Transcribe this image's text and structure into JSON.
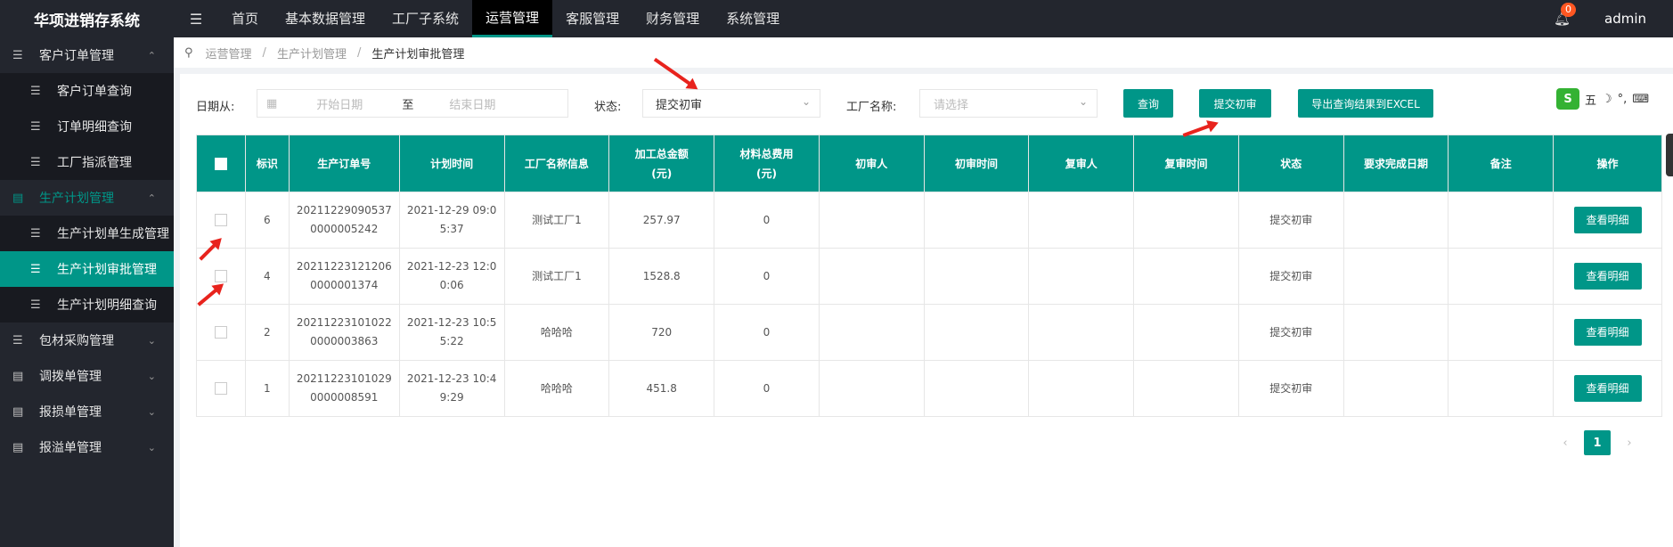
{
  "app": {
    "title": "华项进销存系统",
    "menu_toggle": "☰"
  },
  "topnav": {
    "items": [
      {
        "label": "首页"
      },
      {
        "label": "基本数据管理"
      },
      {
        "label": "工厂子系统"
      },
      {
        "label": "运营管理",
        "active": true
      },
      {
        "label": "客服管理"
      },
      {
        "label": "财务管理"
      },
      {
        "label": "系统管理"
      }
    ],
    "notification_count": "0",
    "user": "admin"
  },
  "sidebar": {
    "groups": [
      {
        "label": "客户订单管理",
        "icon": "list-icon",
        "expanded": true,
        "items": [
          {
            "label": "客户订单查询"
          },
          {
            "label": "订单明细查询"
          },
          {
            "label": "工厂指派管理"
          }
        ]
      },
      {
        "label": "生产计划管理",
        "icon": "chart-icon",
        "expanded": true,
        "items": [
          {
            "label": "生产计划单生成管理"
          },
          {
            "label": "生产计划审批管理",
            "active": true
          },
          {
            "label": "生产计划明细查询"
          }
        ]
      },
      {
        "label": "包材采购管理",
        "icon": "list-icon"
      },
      {
        "label": "调拨单管理",
        "icon": "chart-icon"
      },
      {
        "label": "报损单管理",
        "icon": "chart-icon"
      },
      {
        "label": "报溢单管理",
        "icon": "chart-icon"
      }
    ]
  },
  "breadcrumb": {
    "items": [
      "运营管理",
      "生产计划管理"
    ],
    "current": "生产计划审批管理",
    "separator": "/"
  },
  "filters": {
    "date_label": "日期从:",
    "start_placeholder": "开始日期",
    "to_label": "至",
    "end_placeholder": "结束日期",
    "status_label": "状态:",
    "status_value": "提交初审",
    "factory_label": "工厂名称:",
    "factory_placeholder": "请选择",
    "query_button": "查询",
    "submit_button": "提交初审",
    "export_button": "导出查询结果到EXCEL"
  },
  "ime": {
    "logo": "S",
    "mode": "五",
    "moon": "☽",
    "punct": "°,",
    "kbd": "⌨"
  },
  "table": {
    "headers": [
      "标识",
      "生产订单号",
      "计划时间",
      "工厂名称信息",
      "加工总金额(元)",
      "材料总费用(元)",
      "初审人",
      "初审时间",
      "复审人",
      "复审时间",
      "状态",
      "要求完成日期",
      "备注",
      "操作"
    ],
    "header_lines": [
      [
        "加工总金额",
        "(元)"
      ],
      [
        "材料总费用",
        "(元)"
      ]
    ],
    "action_label": "查看明细",
    "rows": [
      {
        "id": "6",
        "order_no_1": "20211229090537",
        "order_no_2": "0000005242",
        "time_1": "2021-12-29 09:0",
        "time_2": "5:37",
        "factory": "测试工厂1",
        "amount": "257.97",
        "material": "0",
        "status": "提交初审"
      },
      {
        "id": "4",
        "order_no_1": "20211223121206",
        "order_no_2": "0000001374",
        "time_1": "2021-12-23 12:0",
        "time_2": "0:06",
        "factory": "测试工厂1",
        "amount": "1528.8",
        "material": "0",
        "status": "提交初审"
      },
      {
        "id": "2",
        "order_no_1": "20211223101022",
        "order_no_2": "0000003863",
        "time_1": "2021-12-23 10:5",
        "time_2": "5:22",
        "factory": "哈哈哈",
        "amount": "720",
        "material": "0",
        "status": "提交初审"
      },
      {
        "id": "1",
        "order_no_1": "20211223101029",
        "order_no_2": "0000008591",
        "time_1": "2021-12-23 10:4",
        "time_2": "9:29",
        "factory": "哈哈哈",
        "amount": "451.8",
        "material": "0",
        "status": "提交初审"
      }
    ]
  },
  "pagination": {
    "prev": "‹",
    "current": "1",
    "next": "›"
  },
  "colors": {
    "accent": "#009688",
    "dark": "#23262e",
    "badge": "#ff5722",
    "annotation": "#e8231d"
  }
}
